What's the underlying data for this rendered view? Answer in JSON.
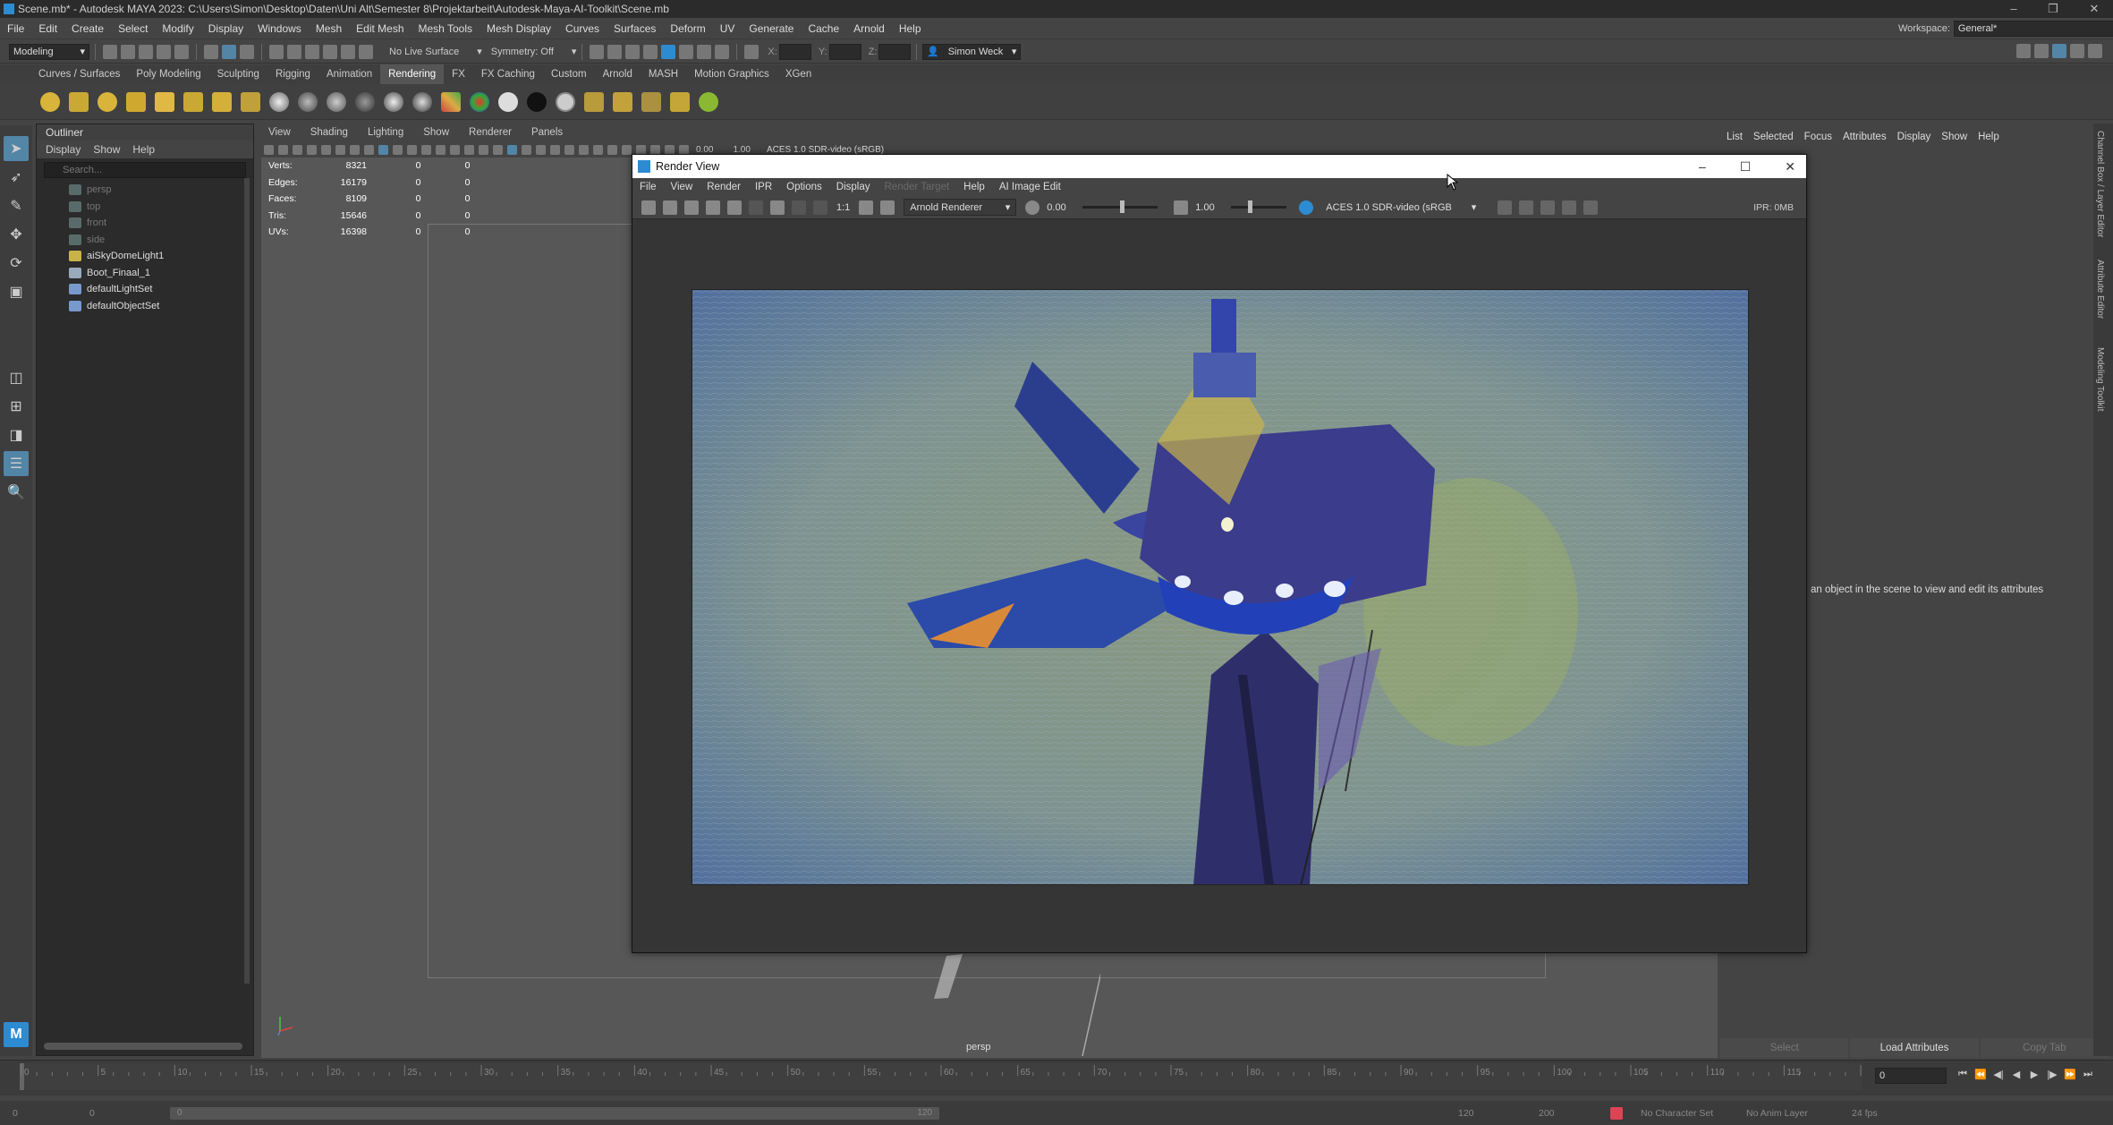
{
  "window": {
    "title": "Scene.mb* - Autodesk MAYA 2023: C:\\Users\\Simon\\Desktop\\Daten\\Uni Alt\\Semester 8\\Projektarbeit\\Autodesk-Maya-AI-Toolkit\\Scene.mb"
  },
  "menubar": {
    "items": [
      "File",
      "Edit",
      "Create",
      "Select",
      "Modify",
      "Display",
      "Windows",
      "Mesh",
      "Edit Mesh",
      "Mesh Tools",
      "Mesh Display",
      "Curves",
      "Surfaces",
      "Deform",
      "UV",
      "Generate",
      "Cache",
      "Arnold",
      "Help"
    ],
    "workspace_label": "Workspace:",
    "workspace_value": "General*"
  },
  "statusline": {
    "mode": "Modeling",
    "live_surface": "No Live Surface",
    "symmetry": "Symmetry: Off",
    "x_label": "X:",
    "y_label": "Y:",
    "z_label": "Z:",
    "user": "Simon Weck"
  },
  "shelf": {
    "tabs": [
      "Curves / Surfaces",
      "Poly Modeling",
      "Sculpting",
      "Rigging",
      "Animation",
      "Rendering",
      "FX",
      "FX Caching",
      "Custom",
      "Arnold",
      "MASH",
      "Motion Graphics",
      "XGen"
    ],
    "active_tab": "Rendering"
  },
  "outliner": {
    "title": "Outliner",
    "menu": [
      "Display",
      "Show",
      "Help"
    ],
    "search_placeholder": "Search...",
    "items": [
      {
        "label": "persp",
        "dim": true,
        "icon": "camera-icon"
      },
      {
        "label": "top",
        "dim": true,
        "icon": "camera-icon"
      },
      {
        "label": "front",
        "dim": true,
        "icon": "camera-icon"
      },
      {
        "label": "side",
        "dim": true,
        "icon": "camera-icon"
      },
      {
        "label": "aiSkyDomeLight1",
        "dim": false,
        "icon": "light-icon"
      },
      {
        "label": "Boot_Finaal_1",
        "dim": false,
        "icon": "mesh-icon"
      },
      {
        "label": "defaultLightSet",
        "dim": false,
        "icon": "set-icon"
      },
      {
        "label": "defaultObjectSet",
        "dim": false,
        "icon": "set-icon"
      }
    ]
  },
  "viewport": {
    "menu": [
      "View",
      "Shading",
      "Lighting",
      "Show",
      "Renderer",
      "Panels"
    ],
    "exposure": "0.00",
    "gamma": "1.00",
    "colorspace": "ACES 1.0 SDR-video (sRGB)",
    "camera": "persp",
    "hud": [
      {
        "label": "Verts:",
        "value": "8321",
        "a": "0",
        "b": "0"
      },
      {
        "label": "Edges:",
        "value": "16179",
        "a": "0",
        "b": "0"
      },
      {
        "label": "Faces:",
        "value": "8109",
        "a": "0",
        "b": "0"
      },
      {
        "label": "Tris:",
        "value": "15646",
        "a": "0",
        "b": "0"
      },
      {
        "label": "UVs:",
        "value": "16398",
        "a": "0",
        "b": "0"
      }
    ]
  },
  "render_view": {
    "title": "Render View",
    "menu": [
      "File",
      "View",
      "Render",
      "IPR",
      "Options",
      "Display",
      "Render Target",
      "Help",
      "AI Image Edit"
    ],
    "disabled_menu": "Render Target",
    "ratio": "1:1",
    "renderer": "Arnold Renderer",
    "exposure": "0.00",
    "gamma": "1.00",
    "colorspace": "ACES 1.0 SDR-video (sRGB",
    "ipr": "IPR: 0MB"
  },
  "attribute_editor": {
    "menu": [
      "List",
      "Selected",
      "Focus",
      "Attributes",
      "Display",
      "Show",
      "Help"
    ],
    "message": "an object in the scene to view and edit its attributes",
    "buttons": {
      "select": "Select",
      "load": "Load Attributes",
      "copy": "Copy Tab"
    },
    "side_tabs": [
      "Channel Box / Layer Editor",
      "Attribute Editor",
      "Modeling Toolkit"
    ]
  },
  "timeline": {
    "ticks": [
      "0",
      "5",
      "10",
      "15",
      "20",
      "25",
      "30",
      "35",
      "40",
      "45",
      "50",
      "55",
      "60",
      "65",
      "70",
      "75",
      "80",
      "85",
      "90",
      "95",
      "100",
      "105",
      "110",
      "115",
      "120"
    ],
    "current_frame": "0",
    "range_start": "0",
    "range_start2": "0",
    "range_inner_end": "120",
    "range_end": "120",
    "range_end2": "200",
    "character_set": "No Character Set",
    "anim_layer": "No Anim Layer",
    "fps": "24 fps"
  },
  "colors": {
    "accent": "#2d8bd1",
    "panel": "#444444",
    "dark": "#2b2b2b",
    "viewport": "#575757"
  }
}
